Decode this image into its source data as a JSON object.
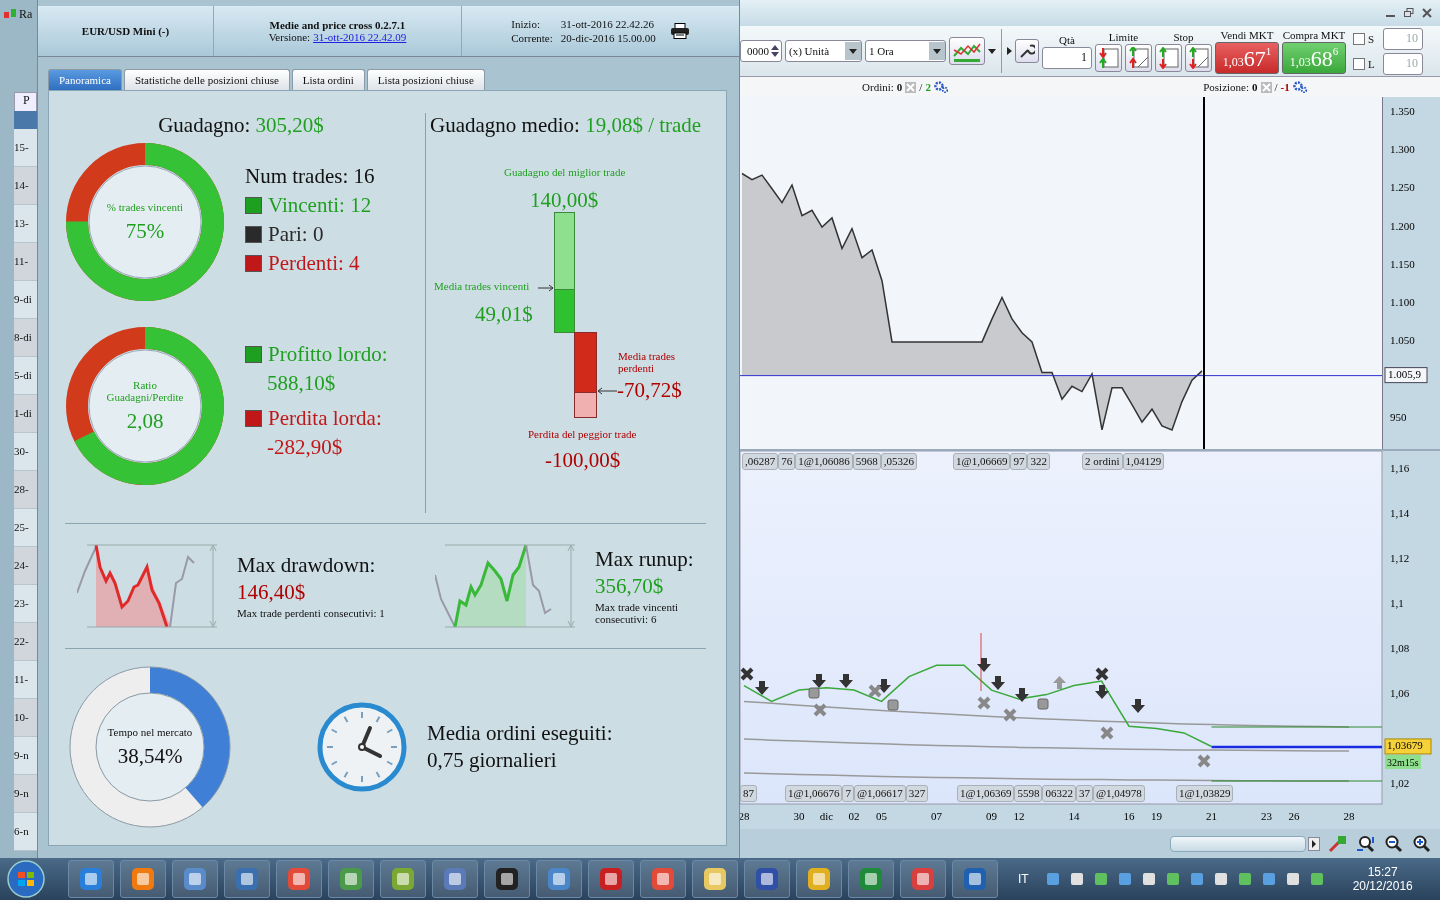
{
  "background_window": {
    "title": "Ra",
    "tab": "P",
    "rows": [
      "15-",
      "14-",
      "13-",
      "11-",
      "9-di",
      "8-di",
      "5-di",
      "1-di",
      "30-",
      "28-",
      "25-",
      "24-",
      "23-",
      "22-",
      "11-",
      "10-",
      "9-n",
      "9-n",
      "6-n"
    ]
  },
  "dialog": {
    "header": {
      "instrument": "EUR/USD Mini (-)",
      "strategy": "Medie and price cross 0.2.7.1",
      "version_label": "Versione:",
      "version": "31-ott-2016 22.42.09",
      "start_label": "Inizio:",
      "start": "31-ott-2016 22.42.26",
      "current_label": "Corrente:",
      "current": "20-dic-2016 15.00.00"
    },
    "tabs": [
      {
        "label": "Panoramica",
        "selected": true
      },
      {
        "label": "Statistiche delle posizioni chiuse",
        "selected": false
      },
      {
        "label": "Lista ordini",
        "selected": false
      },
      {
        "label": "Lista posizioni chiuse",
        "selected": false
      }
    ],
    "overview": {
      "profit": {
        "label": "Guadagno:",
        "value": "305,20$"
      },
      "win_rate": {
        "label": "% trades vincenti",
        "value": "75%",
        "level": 0.75
      },
      "trades": {
        "label": "Num trades: 16",
        "items": [
          {
            "label": "Vincenti: 12",
            "color": "#1f9f1f"
          },
          {
            "label": "Pari: 0",
            "color": "#2a2a2a"
          },
          {
            "label": "Perdenti: 4",
            "color": "#c01818"
          }
        ]
      },
      "ratio": {
        "label": "Ratio Guadagni/Perdite",
        "value": "2,08",
        "level": 0.675
      },
      "gross": [
        {
          "label": "Profitto lordo:",
          "value": "588,10$",
          "color": "#1f9f1f"
        },
        {
          "label": "Perdita lorda:",
          "value": "-282,90$",
          "color": "#c01818"
        }
      ],
      "average": {
        "label": "Guadagno medio:",
        "value": "19,08$ / trade",
        "best_label": "Guadagno del miglior trade",
        "best": "140,00$",
        "avg_win_label": "Media trades vincenti",
        "avg_win": "49,01$",
        "avg_loss_label": "Media trades perdenti",
        "avg_loss": "-70,72$",
        "worst_label": "Perdita del peggior trade",
        "worst": "-100,00$"
      },
      "drawdown": {
        "label": "Max drawdown:",
        "value": "146,40$",
        "note": "Max trade perdenti consecutivi: 1"
      },
      "runup": {
        "label": "Max runup:",
        "value": "356,70$",
        "note": "Max trade vincenti consecutivi: 6"
      },
      "time_in_market": {
        "label": "Tempo nel mercato",
        "value": "38,54%",
        "level": 0.3854
      },
      "orders_per_day": {
        "label": "Media ordini eseguiti:",
        "value": "0,75 giornalieri"
      }
    }
  },
  "trading": {
    "toolbar": {
      "amount": "0000",
      "unit": "(x) Unità",
      "timeframe": "1 Ora",
      "qty_label": "Qtà",
      "qty": "1",
      "limit_label": "Limite",
      "stop_label": "Stop",
      "sell": {
        "label": "Vendi MKT",
        "prefix": "1,03",
        "big": "67",
        "small": "1"
      },
      "buy": {
        "label": "Compra MKT",
        "prefix": "1,03",
        "big": "68",
        "small": "6"
      },
      "options": [
        {
          "label": "S",
          "checked": false,
          "value": "10",
          "disabled": true
        },
        {
          "label": "L",
          "checked": false,
          "value": "10",
          "disabled": true
        }
      ]
    },
    "orders": {
      "label": "Ordini:",
      "count": "0",
      "separator": "/",
      "pending": "2"
    },
    "position": {
      "label": "Posizione:",
      "count": "0",
      "separator": "/",
      "value": "-1"
    },
    "equity_chart": {
      "chart_data": {
        "type": "area",
        "ylim": [
          910,
          1370
        ],
        "yticks": [
          {
            "value": 1350,
            "label": "1.350"
          },
          {
            "value": 1300,
            "label": "1.300"
          },
          {
            "value": 1250,
            "label": "1.250"
          },
          {
            "value": 1200,
            "label": "1.200"
          },
          {
            "value": 1150,
            "label": "1.150"
          },
          {
            "value": 1100,
            "label": "1.100"
          },
          {
            "value": 1050,
            "label": "1.050"
          },
          {
            "value": 950,
            "label": "950"
          }
        ],
        "values": [
          1270,
          1262,
          1268,
          1250,
          1232,
          1255,
          1215,
          1222,
          1200,
          1212,
          1172,
          1198,
          1160,
          1170,
          1130,
          1050,
          1050,
          1050,
          1050,
          1050,
          1050,
          1050,
          1050,
          1050,
          1050,
          1080,
          1108,
          1080,
          1062,
          1050,
          1010,
          1010,
          975,
          992,
          985,
          1008,
          935,
          990,
          990,
          968,
          945,
          962,
          940,
          935,
          972,
          1000,
          1012
        ],
        "ref_lines": [
          {
            "axis": "y",
            "value": 1005.9
          }
        ]
      },
      "marker": "1.005,9"
    },
    "price_chart": {
      "chart_data": {
        "type": "line",
        "ylim": [
          1.0115,
          1.168
        ],
        "categories": [
          "28",
          null,
          "30",
          "dic",
          "02",
          "05",
          null,
          "07",
          null,
          "09",
          "12",
          null,
          "14",
          null,
          "16",
          "19",
          null,
          "21",
          null,
          "23",
          "26",
          null,
          "28"
        ],
        "series": [
          {
            "color": "#3aa83a",
            "values": [
              1.064,
              1.057,
              1.062,
              1.063,
              1.062,
              1.057,
              1.068,
              1.073,
              1.073,
              1.062,
              1.058,
              1.06,
              1.064,
              1.066,
              1.046,
              1.045,
              1.043,
              1.037,
              null,
              null,
              null,
              null,
              null
            ]
          },
          {
            "color": "#999999",
            "values": [
              1.057,
              1.0562,
              1.0553,
              1.0545,
              1.0537,
              1.053,
              1.0523,
              1.0516,
              1.0509,
              1.0503,
              1.0497,
              1.0492,
              1.0487,
              1.0482,
              1.0478,
              1.0474,
              1.047,
              1.0467,
              1.0464,
              1.0462,
              1.046,
              1.0458,
              1.0457
            ]
          },
          {
            "color": "#999999",
            "values": [
              1.0403,
              1.0398,
              1.0394,
              1.039,
              1.0386,
              1.0382,
              1.0378,
              1.0375,
              1.0372,
              1.0369,
              1.0366,
              1.0364,
              1.0362,
              1.036,
              1.0358,
              1.0356,
              1.0355,
              1.0354,
              1.0353,
              1.0352,
              1.0351,
              1.035,
              1.035
            ]
          },
          {
            "color": "#999999",
            "values": [
              1.0252,
              1.0249,
              1.0246,
              1.0243,
              1.024,
              1.0237,
              1.0235,
              1.0233,
              1.0231,
              1.0229,
              1.0227,
              1.0225,
              1.0224,
              1.0223,
              1.0222,
              1.0221,
              1.022,
              1.0219,
              1.0218,
              1.0218,
              1.0217,
              1.0217,
              1.0217
            ]
          }
        ],
        "yticks": [
          {
            "value": 1.16,
            "label": "1,16"
          },
          {
            "value": 1.14,
            "label": "1,14"
          },
          {
            "value": 1.12,
            "label": "1,12"
          },
          {
            "value": 1.1,
            "label": "1,1"
          },
          {
            "value": 1.08,
            "label": "1,08"
          },
          {
            "value": 1.06,
            "label": "1,06"
          },
          {
            "value": 1.02,
            "label": "1,02"
          }
        ]
      },
      "price": "1,03679",
      "timer": "32m15s",
      "top_tags": [
        [
          ",06287",
          "76",
          "1@1,06086",
          "5968",
          ",05326"
        ],
        [
          "1@1,06669",
          "97",
          "322"
        ],
        [
          "2 ordini",
          "1,04129"
        ]
      ],
      "bottom_tags": [
        [
          "87"
        ],
        [
          "1@1,06676",
          "7",
          "@1,06617",
          "327"
        ],
        [
          "1@1,06369",
          "5598",
          "06322",
          "37",
          "@1,04978"
        ],
        [
          "1@1,03829"
        ]
      ]
    }
  },
  "taskbar": {
    "language": "IT",
    "time": "15:27",
    "date": "20/12/2016"
  }
}
